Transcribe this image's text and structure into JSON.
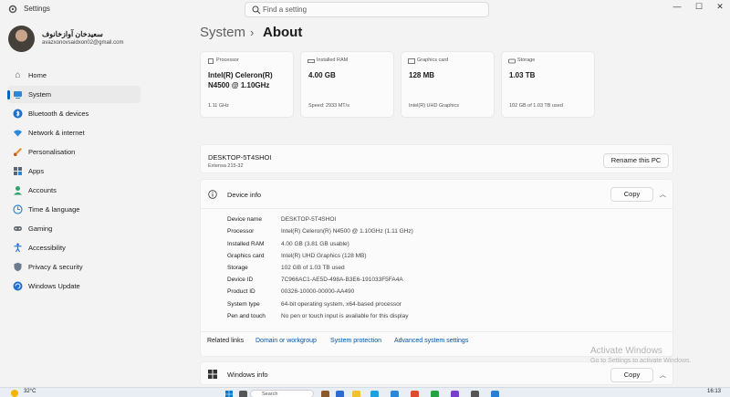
{
  "window": {
    "title": "Settings",
    "minimize": "—",
    "maximize": "☐",
    "close": "✕"
  },
  "search": {
    "placeholder": "Find a setting"
  },
  "profile": {
    "name": "سعیدخان آوازخانوف",
    "email": "avazxonovsaidxon02@gmail.com"
  },
  "sidebar": {
    "items": [
      {
        "label": "Home",
        "icon": "home-icon"
      },
      {
        "label": "System",
        "icon": "system-icon"
      },
      {
        "label": "Bluetooth & devices",
        "icon": "bluetooth-icon"
      },
      {
        "label": "Network & internet",
        "icon": "wifi-icon"
      },
      {
        "label": "Personalisation",
        "icon": "brush-icon"
      },
      {
        "label": "Apps",
        "icon": "apps-icon"
      },
      {
        "label": "Accounts",
        "icon": "accounts-icon"
      },
      {
        "label": "Time & language",
        "icon": "globe-clock-icon"
      },
      {
        "label": "Gaming",
        "icon": "gamepad-icon"
      },
      {
        "label": "Accessibility",
        "icon": "accessibility-icon"
      },
      {
        "label": "Privacy & security",
        "icon": "shield-icon"
      },
      {
        "label": "Windows Update",
        "icon": "update-icon"
      }
    ]
  },
  "breadcrumb": {
    "parent": "System",
    "separator": "›",
    "current": "About"
  },
  "cards": [
    {
      "heading": "Processor",
      "value": "Intel(R) Celeron(R) N4500 @ 1.10GHz",
      "sub": "1.11 GHz",
      "icon": "processor-icon"
    },
    {
      "heading": "Installed RAM",
      "value": "4.00 GB",
      "sub": "Speed: 2933 MT/s",
      "icon": "ram-icon"
    },
    {
      "heading": "Graphics card",
      "value": "128 MB",
      "sub": "Intel(R) UHD Graphics",
      "icon": "graphics-card-icon"
    },
    {
      "heading": "Storage",
      "value": "1.03 TB",
      "sub": "102 GB of 1.03 TB used",
      "icon": "storage-icon"
    }
  ],
  "device": {
    "name": "DESKTOP-5T4SHOI",
    "model": "Extensa 215-32",
    "rename_label": "Rename this PC"
  },
  "device_info": {
    "title": "Device info",
    "copy_label": "Copy",
    "specs": [
      {
        "label": "Device name",
        "value": "DESKTOP-5T4SHOI"
      },
      {
        "label": "Processor",
        "value": "Intel(R) Celeron(R) N4500 @ 1.10GHz (1.11 GHz)"
      },
      {
        "label": "Installed RAM",
        "value": "4.00 GB (3.81 GB usable)"
      },
      {
        "label": "Graphics card",
        "value": "Intel(R) UHD Graphics (128 MB)"
      },
      {
        "label": "Storage",
        "value": "102 GB of 1.03 TB used"
      },
      {
        "label": "Device ID",
        "value": "7C966AC1-AE5D-498A-B3E6-191033F5FA4A"
      },
      {
        "label": "Product ID",
        "value": "00326-10000-00000-AA490"
      },
      {
        "label": "System type",
        "value": "64-bit operating system, x64-based processor"
      },
      {
        "label": "Pen and touch",
        "value": "No pen or touch input is available for this display"
      }
    ]
  },
  "related_links": {
    "label": "Related links",
    "links": [
      "Domain or workgroup",
      "System protection",
      "Advanced system settings"
    ]
  },
  "windows_info": {
    "title": "Windows info",
    "copy_label": "Copy"
  },
  "watermark": {
    "line1": "Activate Windows",
    "line2": "Go to Settings to activate Windows."
  },
  "taskbar": {
    "weather": "32°C",
    "search_label": "Search",
    "time": "16:13"
  },
  "colors": {
    "accent": "#0067c0",
    "link": "#0054a6"
  }
}
